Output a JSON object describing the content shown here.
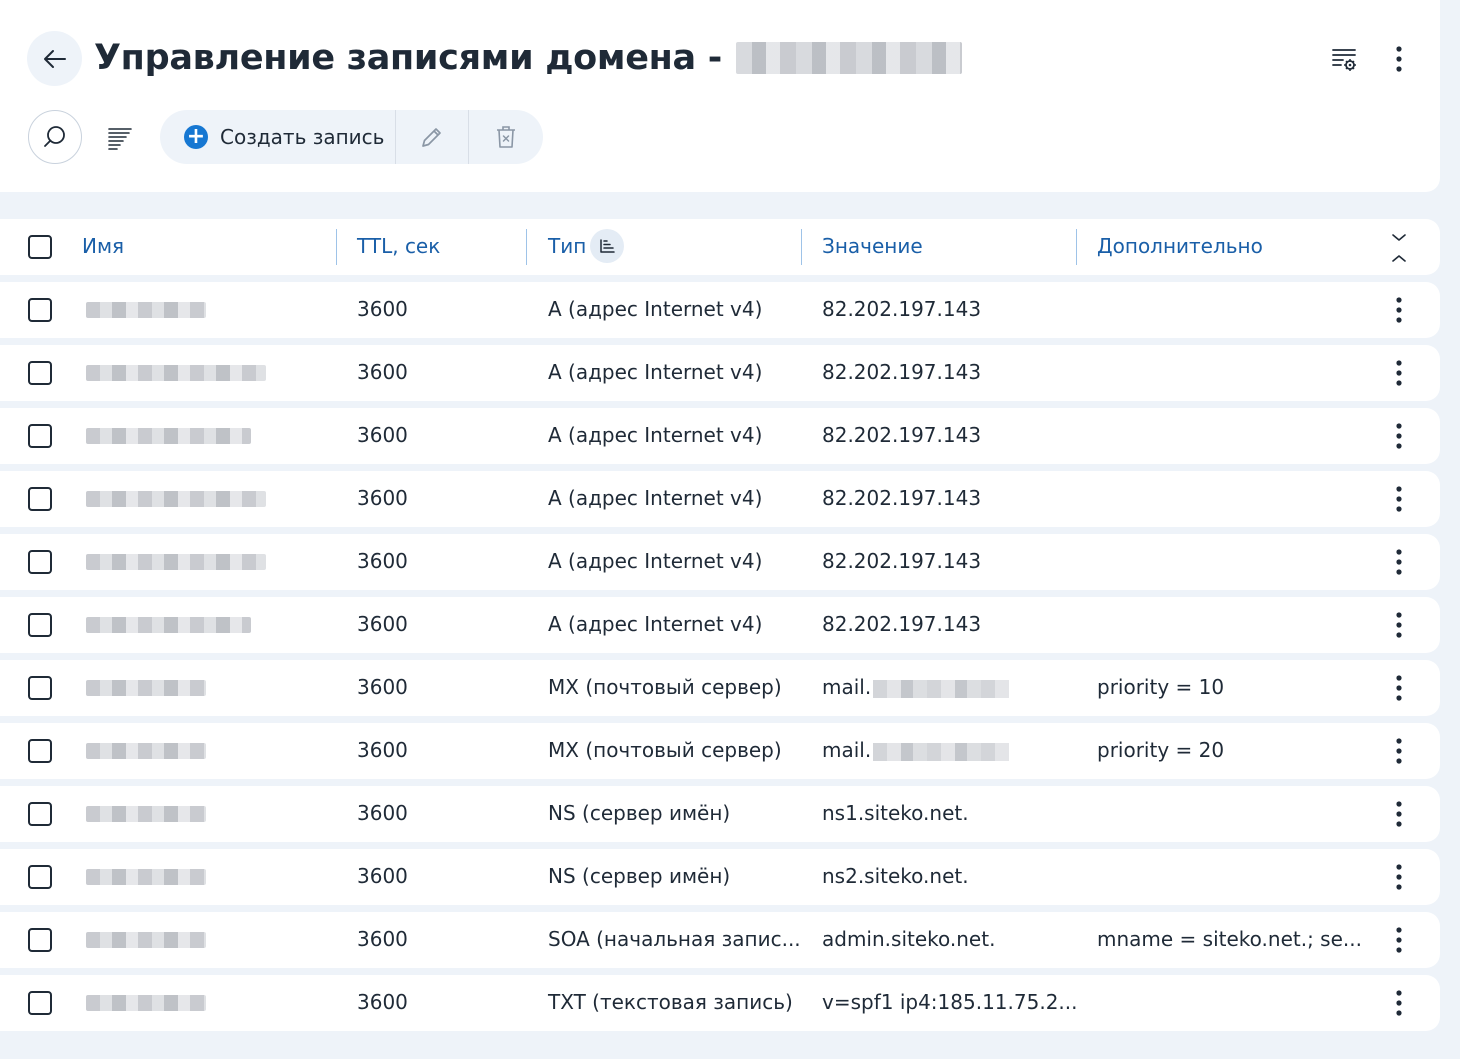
{
  "header": {
    "title": "Управление записями домена -",
    "create_label": "Создать запись",
    "icons": {
      "back": "arrow-left-icon",
      "settings": "table-settings-icon",
      "more": "kebab-icon",
      "search": "search-icon",
      "filter": "filter-lines-icon",
      "create": "plus-circle-icon",
      "edit": "pencil-icon",
      "delete": "trash-icon"
    },
    "accent": "#1677d2"
  },
  "table": {
    "columns": [
      "Имя",
      "TTL, сек",
      "Тип",
      "Значение",
      "Дополнительно"
    ],
    "rows": [
      {
        "ttl": "3600",
        "type": "A (адрес Internet v4)",
        "value": "82.202.197.143",
        "value_prefix": "",
        "extra": ""
      },
      {
        "ttl": "3600",
        "type": "A (адрес Internet v4)",
        "value": "82.202.197.143",
        "value_prefix": "",
        "extra": ""
      },
      {
        "ttl": "3600",
        "type": "A (адрес Internet v4)",
        "value": "82.202.197.143",
        "value_prefix": "",
        "extra": ""
      },
      {
        "ttl": "3600",
        "type": "A (адрес Internet v4)",
        "value": "82.202.197.143",
        "value_prefix": "",
        "extra": ""
      },
      {
        "ttl": "3600",
        "type": "A (адрес Internet v4)",
        "value": "82.202.197.143",
        "value_prefix": "",
        "extra": ""
      },
      {
        "ttl": "3600",
        "type": "A (адрес Internet v4)",
        "value": "82.202.197.143",
        "value_prefix": "",
        "extra": ""
      },
      {
        "ttl": "3600",
        "type": "MX (почтовый сервер)",
        "value": "",
        "value_prefix": "mail.",
        "extra": "priority = 10"
      },
      {
        "ttl": "3600",
        "type": "MX (почтовый сервер)",
        "value": "",
        "value_prefix": "mail.",
        "extra": "priority = 20"
      },
      {
        "ttl": "3600",
        "type": "NS (сервер имён)",
        "value": "ns1.siteko.net.",
        "value_prefix": "",
        "extra": ""
      },
      {
        "ttl": "3600",
        "type": "NS (сервер имён)",
        "value": "ns2.siteko.net.",
        "value_prefix": "",
        "extra": ""
      },
      {
        "ttl": "3600",
        "type": "SOA (начальная запис...",
        "value": "admin.siteko.net.",
        "value_prefix": "",
        "extra": "mname = siteko.net.; se..."
      },
      {
        "ttl": "3600",
        "type": "TXT (текстовая запись)",
        "value": "v=spf1 ip4:185.11.75.2...",
        "value_prefix": "",
        "extra": ""
      }
    ]
  }
}
